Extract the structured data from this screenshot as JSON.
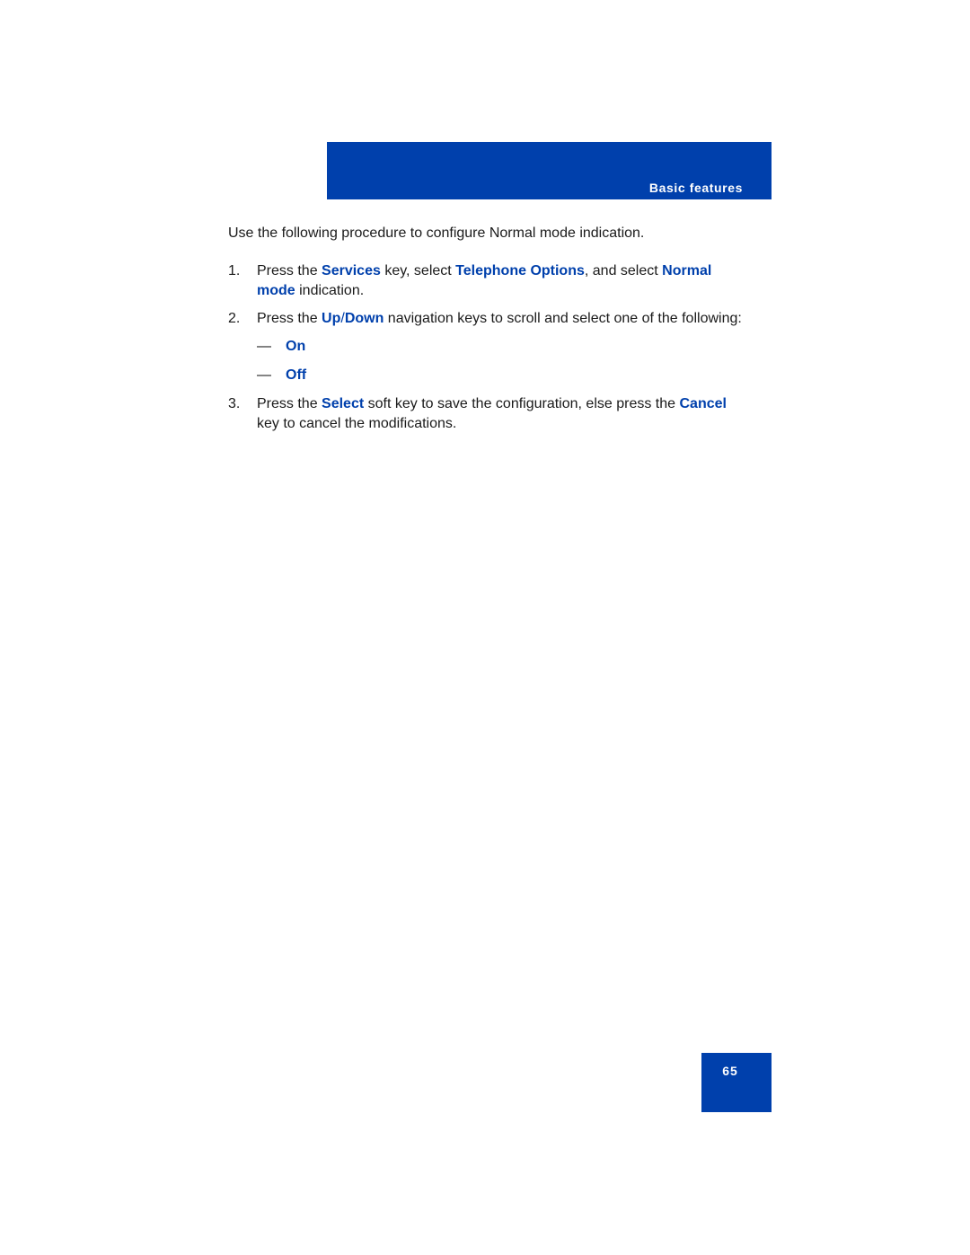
{
  "header": {
    "section_title": "Basic features"
  },
  "intro": "Use the following procedure to configure Normal mode indication.",
  "steps": [
    {
      "number": "1.",
      "t1": "Press the ",
      "k1": "Services",
      "t2": " key, select ",
      "k2": "Telephone Options",
      "t3": ", and select ",
      "k3": "Normal mode",
      "t4": " indication."
    },
    {
      "number": "2.",
      "t1": "Press the ",
      "k1": "Up",
      "slash": "/",
      "k2": "Down",
      "t2": " navigation keys to scroll and select one of the following:",
      "options": [
        {
          "dash": "—",
          "label": "On"
        },
        {
          "dash": "—",
          "label": "Off"
        }
      ]
    },
    {
      "number": "3.",
      "t1": "Press the ",
      "k1": "Select",
      "t2": " soft key to save the configuration, else press the ",
      "k2": "Cancel",
      "t3": " key to cancel the modifications."
    }
  ],
  "footer": {
    "page_number": "65"
  },
  "colors": {
    "brand_blue": "#0040ac",
    "keyword_blue": "#0040ac",
    "body_text": "#1a1a1a"
  }
}
